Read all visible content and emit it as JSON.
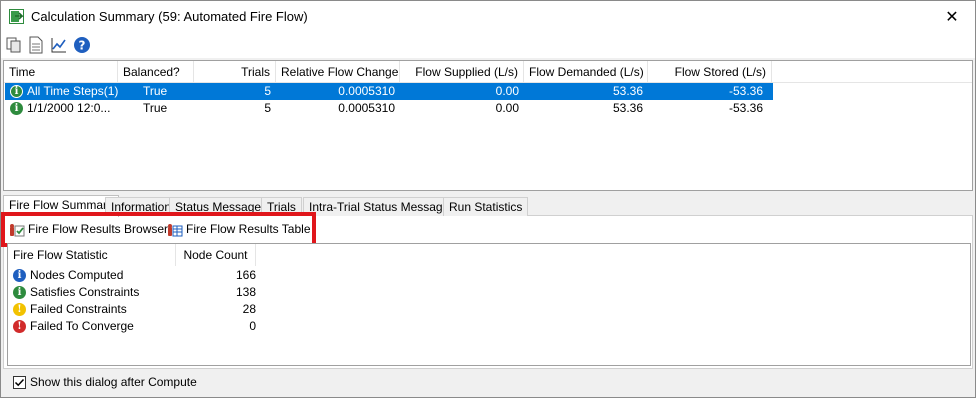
{
  "window": {
    "title": "Calculation Summary (59: Automated Fire Flow)",
    "close_glyph": "✕"
  },
  "toolbar": {
    "buttons": [
      "copy-icon",
      "report-icon",
      "chart-icon",
      "help-icon"
    ]
  },
  "summary_grid": {
    "columns": [
      "Time",
      "Balanced?",
      "Trials",
      "Relative Flow Change",
      "Flow Supplied (L/s)",
      "Flow Demanded (L/s)",
      "Flow Stored (L/s)"
    ],
    "rows": [
      {
        "time": "All Time Steps(1)",
        "balanced": "True",
        "trials": "5",
        "relative_flow_change": "0.0005310",
        "flow_supplied": "0.00",
        "flow_demanded": "53.36",
        "flow_stored": "-53.36"
      },
      {
        "time": "1/1/2000 12:0...",
        "balanced": "True",
        "trials": "5",
        "relative_flow_change": "0.0005310",
        "flow_supplied": "0.00",
        "flow_demanded": "53.36",
        "flow_stored": "-53.36"
      }
    ]
  },
  "tabs": [
    "Fire Flow Summary",
    "Information",
    "Status Messages",
    "Trials",
    "Intra-Trial Status Messages",
    "Run Statistics"
  ],
  "sub_toolbar": {
    "browser_label": "Fire Flow Results Browser",
    "table_label": "Fire Flow Results Table"
  },
  "fire_flow_grid": {
    "columns": [
      "Fire Flow Statistic",
      "Node Count"
    ],
    "rows": [
      {
        "label": "Nodes Computed",
        "value": "166",
        "icon": "info-blue-icon",
        "color": "#1f5fbf",
        "glyph": "i"
      },
      {
        "label": "Satisfies Constraints",
        "value": "138",
        "icon": "info-green-icon",
        "color": "#2e8b3e",
        "glyph": "i"
      },
      {
        "label": "Failed Constraints",
        "value": "28",
        "icon": "warning-yellow-icon",
        "color": "#f2c200",
        "glyph": "!"
      },
      {
        "label": "Failed To Converge",
        "value": "0",
        "icon": "error-red-icon",
        "color": "#d12b2b",
        "glyph": "!"
      }
    ]
  },
  "footer": {
    "checkbox_label": "Show this dialog after Compute",
    "checked": true
  },
  "colors": {
    "selection": "#0078d7",
    "highlight_box": "#e0161b"
  }
}
